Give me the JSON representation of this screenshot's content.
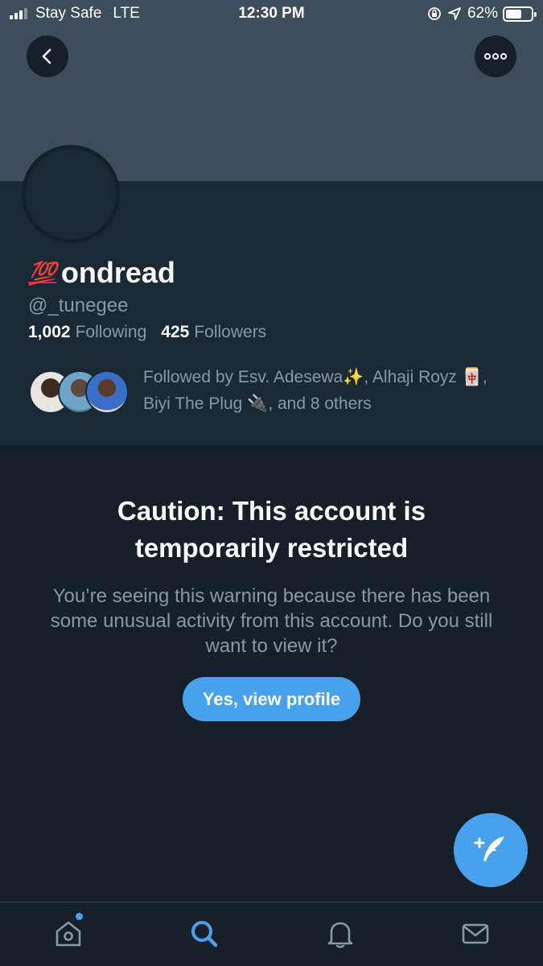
{
  "status_bar": {
    "carrier": "Stay Safe",
    "network": "LTE",
    "time": "12:30 PM",
    "battery": "62%",
    "battery_level": 0.62
  },
  "profile": {
    "emoji": "💯",
    "name": "ondread",
    "handle": "@_tunegee",
    "following_count": "1,002",
    "following_label": "Following",
    "followers_count": "425",
    "followers_label": "Followers",
    "followed_by": "Followed by Esv. Adesewa✨, Alhaji Royz 🀄, Biyi The Plug 🔌, and 8 others"
  },
  "caution": {
    "title": "Caution: This account is temporarily restricted",
    "message": "You’re seeing this warning because there has been some unusual activity from this account. Do you still want to view it?",
    "button_label": "Yes, view profile"
  },
  "icons": {
    "back": "chevron-left-icon",
    "more": "more-horizontal-icon",
    "compose": "compose-tweet-icon",
    "tabs": [
      "home-icon",
      "search-icon",
      "notifications-icon",
      "messages-icon"
    ]
  },
  "colors": {
    "background": "#15202b",
    "accent": "#4aa1eb",
    "muted_text": "#8899a6"
  }
}
